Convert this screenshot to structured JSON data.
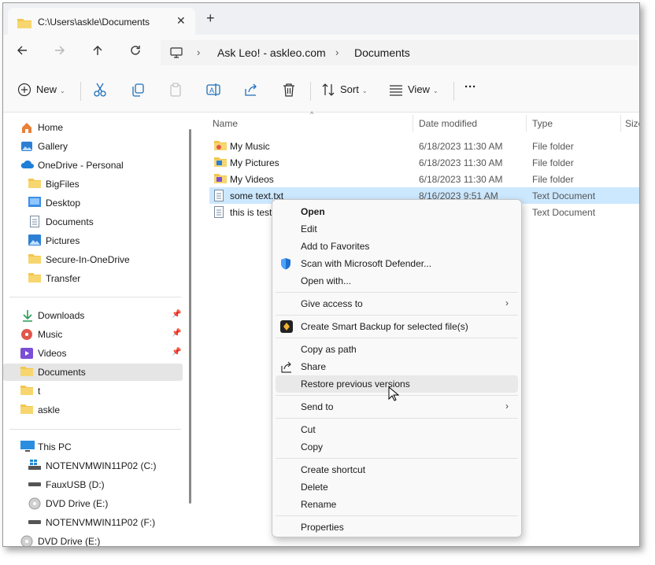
{
  "window": {
    "tab_title": "C:\\Users\\askle\\Documents",
    "tab_close": "✕",
    "new_tab": "+"
  },
  "address": {
    "crumbs": [
      "Ask Leo! - askleo.com",
      "Documents"
    ]
  },
  "commands": {
    "new": "New",
    "sort": "Sort",
    "view": "View",
    "more": "···"
  },
  "nav": {
    "home": "Home",
    "gallery": "Gallery",
    "onedrive": "OneDrive - Personal",
    "onedrive_children": [
      "BigFiles",
      "Desktop",
      "Documents",
      "Pictures",
      "Secure-In-OneDrive",
      "Transfer"
    ],
    "quick": [
      "Downloads",
      "Music",
      "Videos",
      "Documents",
      "t",
      "askle"
    ],
    "this_pc": "This PC",
    "drives": [
      "NOTENVMWIN11P02 (C:)",
      "FauxUSB (D:)",
      "DVD Drive (E:)",
      "NOTENVMWIN11P02 (F:)"
    ],
    "dvd_root": "DVD Drive (E:)"
  },
  "columns": {
    "name": "Name",
    "date": "Date modified",
    "type": "Type",
    "size": "Size"
  },
  "files": [
    {
      "name": "My Music",
      "date": "6/18/2023 11:30 AM",
      "type": "File folder"
    },
    {
      "name": "My Pictures",
      "date": "6/18/2023 11:30 AM",
      "type": "File folder"
    },
    {
      "name": "My Videos",
      "date": "6/18/2023 11:30 AM",
      "type": "File folder"
    },
    {
      "name": "some text.txt",
      "date": "8/16/2023 9:51 AM",
      "type": "Text Document"
    },
    {
      "name": "this is test",
      "date": "",
      "type": "Text Document"
    }
  ],
  "context_menu": {
    "open": "Open",
    "edit": "Edit",
    "add_favorites": "Add to Favorites",
    "scan": "Scan with Microsoft Defender...",
    "open_with": "Open with...",
    "give_access": "Give access to",
    "smart_backup": "Create Smart Backup for selected file(s)",
    "copy_path": "Copy as path",
    "share": "Share",
    "restore": "Restore previous versions",
    "send_to": "Send to",
    "cut": "Cut",
    "copy": "Copy",
    "create_shortcut": "Create shortcut",
    "delete": "Delete",
    "rename": "Rename",
    "properties": "Properties"
  },
  "colors": {
    "accent": "#0067c0",
    "selection": "#cce8ff",
    "folder": "#f3c64c"
  }
}
